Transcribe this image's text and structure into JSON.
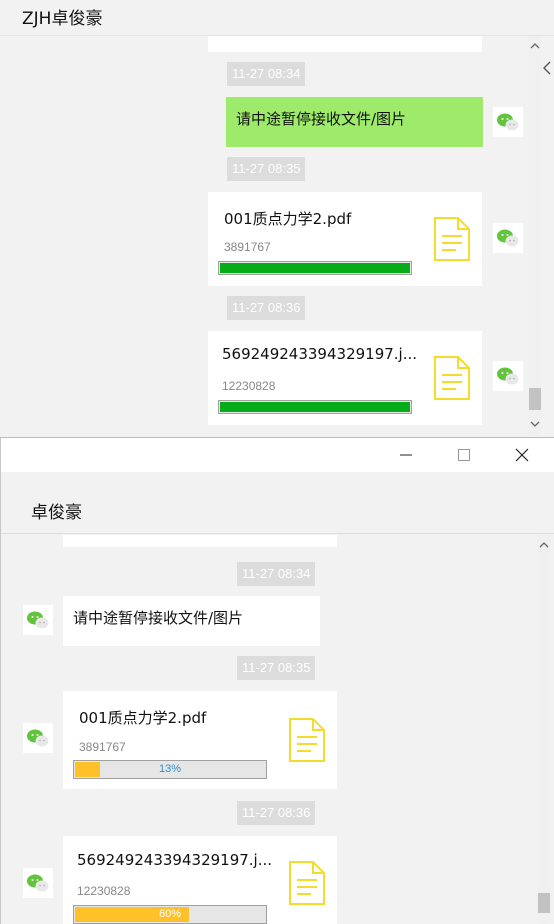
{
  "top_window": {
    "title": "ZJH卓俊豪",
    "messages": {
      "ts1": "11-27 08:34",
      "text_msg": "请中途暂停接收文件/图片",
      "ts2": "11-27 08:35",
      "file1": {
        "name": "001质点力学2.pdf",
        "size": "3891767",
        "progress": 1.0
      },
      "ts3": "11-27 08:36",
      "file2": {
        "name": "569249243394329197.j...",
        "size": "12230828",
        "progress": 1.0
      }
    },
    "colors": {
      "sent_bubble": "#9eea6a",
      "progress_complete": "#06ad18"
    }
  },
  "bottom_window": {
    "window_controls": {
      "minimize": "—",
      "maximize": "☐",
      "close": "✕"
    },
    "title": "卓俊豪",
    "messages": {
      "ts1": "11-27 08:34",
      "text_msg": "请中途暂停接收文件/图片",
      "ts2": "11-27 08:35",
      "file1": {
        "name": "001质点力学2.pdf",
        "size": "3891767",
        "progress": 0.13,
        "progress_label": "13%"
      },
      "ts3": "11-27 08:36",
      "file2": {
        "name": "569249243394329197.j...",
        "size": "12230828",
        "progress": 0.6,
        "progress_label": "60%"
      }
    },
    "colors": {
      "progress_partial": "#fec12a",
      "file_icon": "#f3dc2c"
    }
  },
  "icons": {
    "avatar": "wechat-avatar-icon",
    "file": "document-icon",
    "scroll_up": "chevron-up-icon",
    "scroll_down": "chevron-down-icon"
  }
}
